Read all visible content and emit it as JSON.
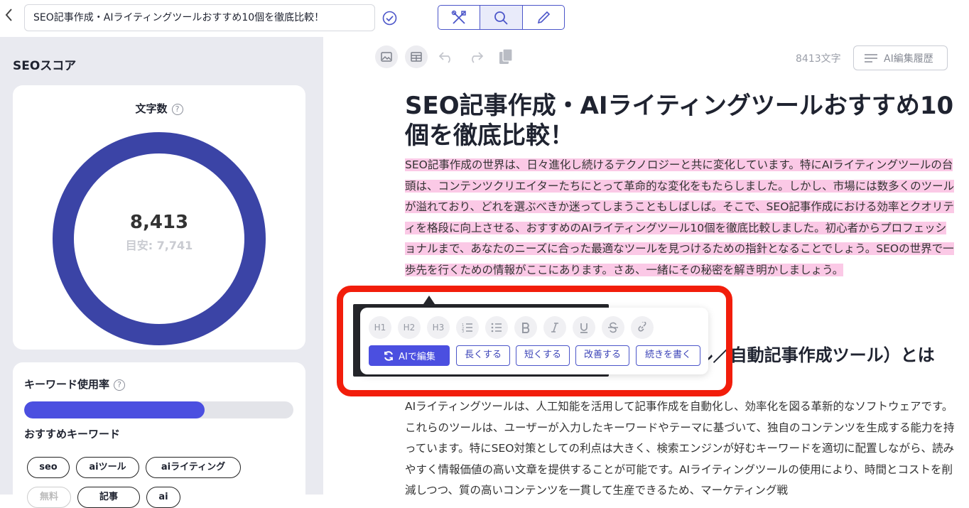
{
  "header": {
    "back_icon": "chevron-left-icon",
    "title_value": "SEO記事作成・AIライティングツールおすすめ10個を徹底比較！",
    "mode_icons": [
      "tools-icon",
      "search-icon",
      "pencil-icon"
    ]
  },
  "seo": {
    "title": "SEOスコア",
    "word_count_label": "文字数",
    "help_mark": "?",
    "count": "8,413",
    "target": "目安: 7,741",
    "count_value": 8413,
    "keyword_label": "キーワード使用率",
    "keyword_usage_fraction": 0.67,
    "recommended_label": "おすすめキーワード",
    "chips": [
      "seo",
      "aiツール",
      "aiライティング",
      "無料",
      "記事",
      "ai"
    ]
  },
  "editor": {
    "char_count": "8413文字",
    "history_label": "AI編集履歴",
    "heading": "SEO記事作成・AIライティングツールおすすめ10個を徹底比較！",
    "intro": "SEO記事作成の世界は、日々進化し続けるテクノロジーと共に変化しています。特にAIライティングツールの台頭は、コンテンツクリエイターたちにとって革命的な変化をもたらしました。しかし、市場には数多くのツールが溢れており、どれを選ぶべきか迷ってしまうこともしばしば。そこで、SEO記事作成における効率とクオリティを格段に向上させる、おすすめのAIライティングツール10個を徹底比較しました。初心者からプロフェッショナルまで、あなたのニーズに合った最適なツールを見つけるための指針となることでしょう。SEOの世界で一歩先を行くための情報がここにあります。さあ、一緒にその秘密を解き明かしましょう。",
    "subheading": "AIライティングツール（文章生成ツール／自動記事作成ツール）とは",
    "body": "AIライティングツールは、人工知能を活用して記事作成を自動化し、効率化を図る革新的なソフトウェアです。これらのツールは、ユーザーが入力したキーワードやテーマに基づいて、独自のコンテンツを生成する能力を持っています。特にSEO対策としての利点は大きく、検索エンジンが好むキーワードを適切に配置しながら、読みやすく情報価値の高い文章を提供することが可能です。AIライティングツールの使用により、時間とコストを削減しつつ、質の高いコンテンツを一貫して生産できるため、マーケティング戦"
  },
  "popup": {
    "format_buttons": [
      "H1",
      "H2",
      "H3"
    ],
    "ai_edit_label": "AIで編集",
    "actions": [
      "長くする",
      "短くする",
      "改善する",
      "続きを書く"
    ]
  },
  "colors": {
    "accent": "#4b4fe0",
    "donut": "#3b44a6",
    "highlight": "#fbc9e6",
    "annotation": "#f21d0b"
  }
}
